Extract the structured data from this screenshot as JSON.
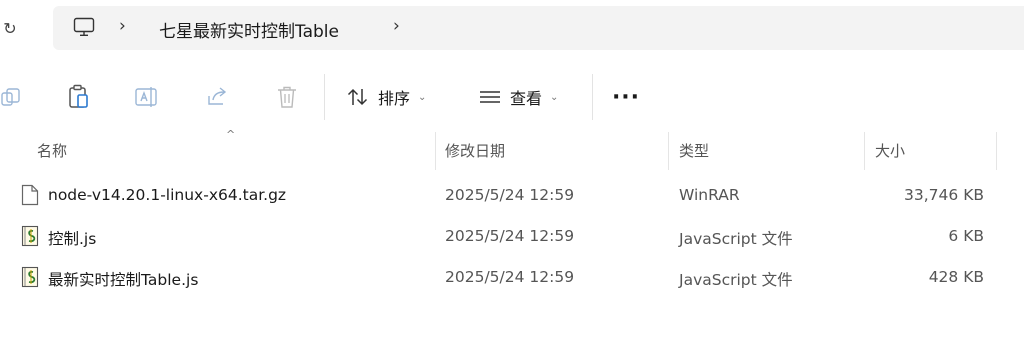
{
  "address": {
    "refresh_glyph": "↻",
    "separator": "›",
    "path": "七星最新实时控制Table"
  },
  "toolbar": {
    "sort_label": "排序",
    "view_label": "查看",
    "more_label": "···"
  },
  "columns": {
    "name": "名称",
    "date": "修改日期",
    "type": "类型",
    "size": "大小",
    "sort_indicator": "^"
  },
  "files": [
    {
      "name": "node-v14.20.1-linux-x64.tar.gz",
      "date": "2025/5/24 12:59",
      "type": "WinRAR",
      "size": "33,746 KB",
      "icon": "blank-file-icon"
    },
    {
      "name": "控制.js",
      "date": "2025/5/24 12:59",
      "type": "JavaScript 文件",
      "size": "6 KB",
      "icon": "js-script-icon"
    },
    {
      "name": "最新实时控制Table.js",
      "date": "2025/5/24 12:59",
      "type": "JavaScript 文件",
      "size": "428 KB",
      "icon": "js-script-icon"
    }
  ]
}
